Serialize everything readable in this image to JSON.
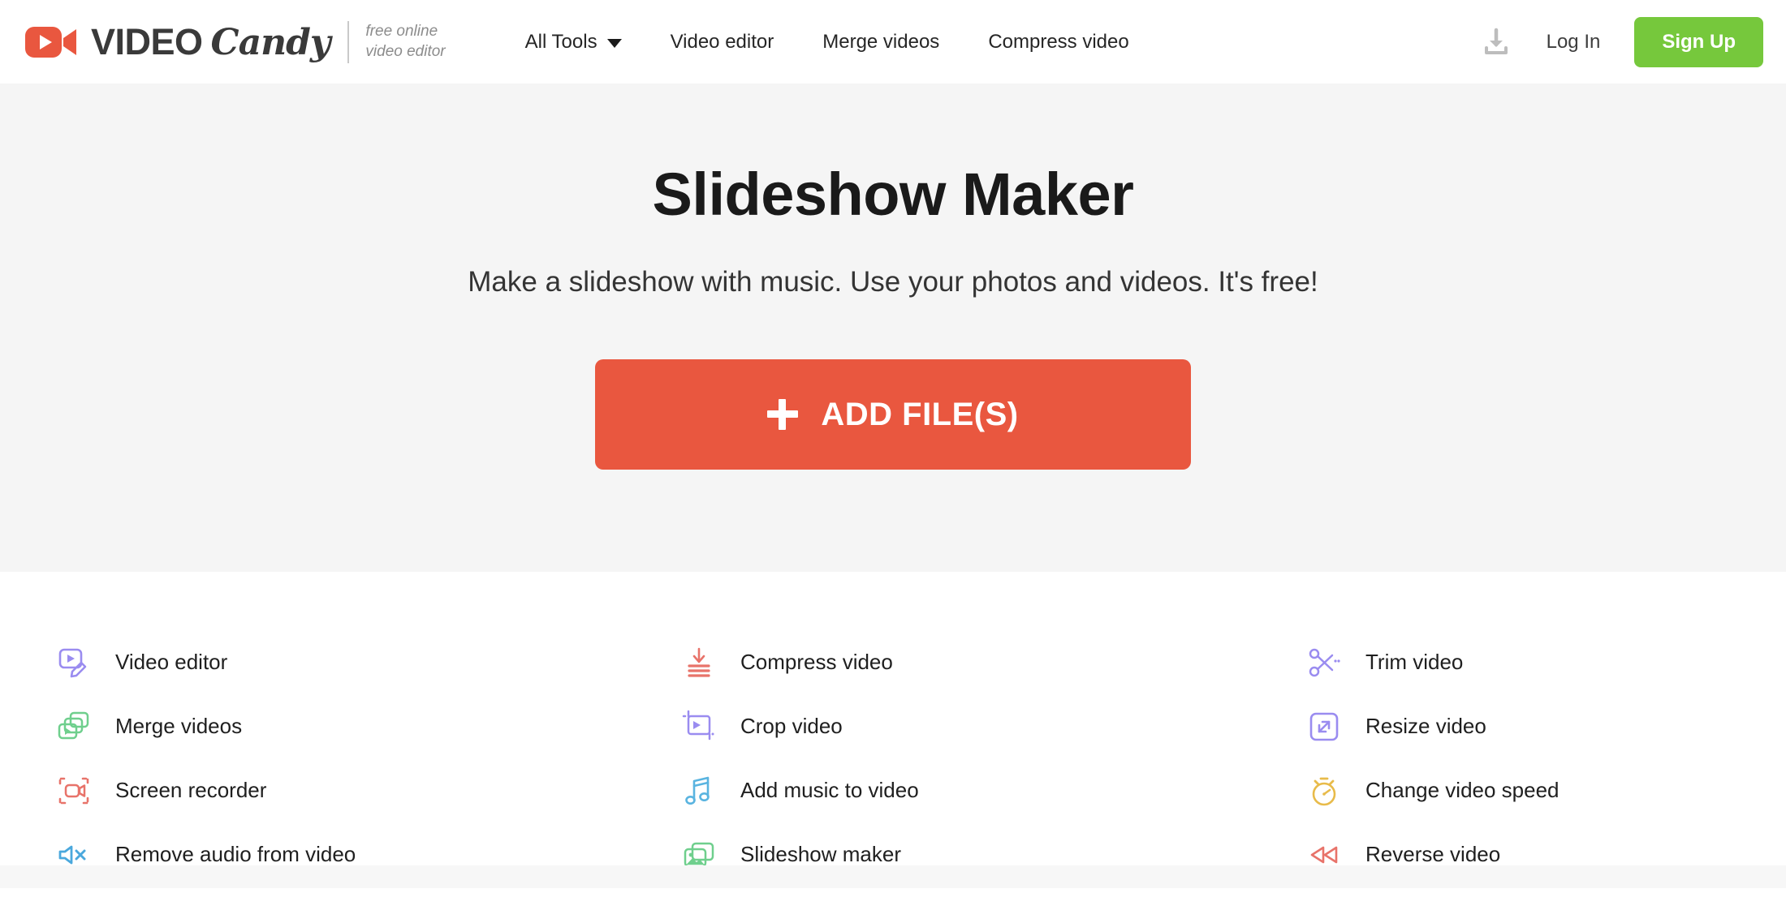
{
  "header": {
    "logo": {
      "icon": "video-camera-icon",
      "word_primary": "VIDEO",
      "word_secondary": "Candy",
      "tagline_line1": "free online",
      "tagline_line2": "video editor"
    },
    "nav": [
      {
        "label": "All Tools",
        "has_caret": true
      },
      {
        "label": "Video editor",
        "has_caret": false
      },
      {
        "label": "Merge videos",
        "has_caret": false
      },
      {
        "label": "Compress video",
        "has_caret": false
      }
    ],
    "download_icon": "download-icon",
    "login_label": "Log In",
    "signup_label": "Sign Up"
  },
  "hero": {
    "title": "Slideshow Maker",
    "subtitle": "Make a slideshow with music. Use your photos and videos. It's free!",
    "cta_label": "ADD FILE(S)",
    "cta_icon": "plus-icon"
  },
  "tools": [
    {
      "label": "Video editor",
      "icon": "video-edit-icon",
      "color": "#9a8cf0"
    },
    {
      "label": "Compress video",
      "icon": "compress-icon",
      "color": "#e8736a"
    },
    {
      "label": "Trim video",
      "icon": "scissors-icon",
      "color": "#9a8cf0"
    },
    {
      "label": "Merge videos",
      "icon": "merge-videos-icon",
      "color": "#6fcf8d"
    },
    {
      "label": "Crop video",
      "icon": "crop-icon",
      "color": "#9a8cf0"
    },
    {
      "label": "Resize video",
      "icon": "resize-icon",
      "color": "#9a8cf0"
    },
    {
      "label": "Screen recorder",
      "icon": "screen-record-icon",
      "color": "#e8736a"
    },
    {
      "label": "Add music to video",
      "icon": "music-note-icon",
      "color": "#5ab4e0"
    },
    {
      "label": "Change video speed",
      "icon": "stopwatch-icon",
      "color": "#e8bb4a"
    },
    {
      "label": "Remove audio from video",
      "icon": "mute-speaker-icon",
      "color": "#4aa8dd"
    },
    {
      "label": "Slideshow maker",
      "icon": "slideshow-icon",
      "color": "#6fcf8d"
    },
    {
      "label": "Reverse video",
      "icon": "rewind-icon",
      "color": "#e8736a"
    }
  ],
  "colors": {
    "brand_orange": "#e9573f",
    "signup_green": "#76c83c",
    "hero_background": "#f5f5f5",
    "text_dark": "#1a1a1a"
  }
}
